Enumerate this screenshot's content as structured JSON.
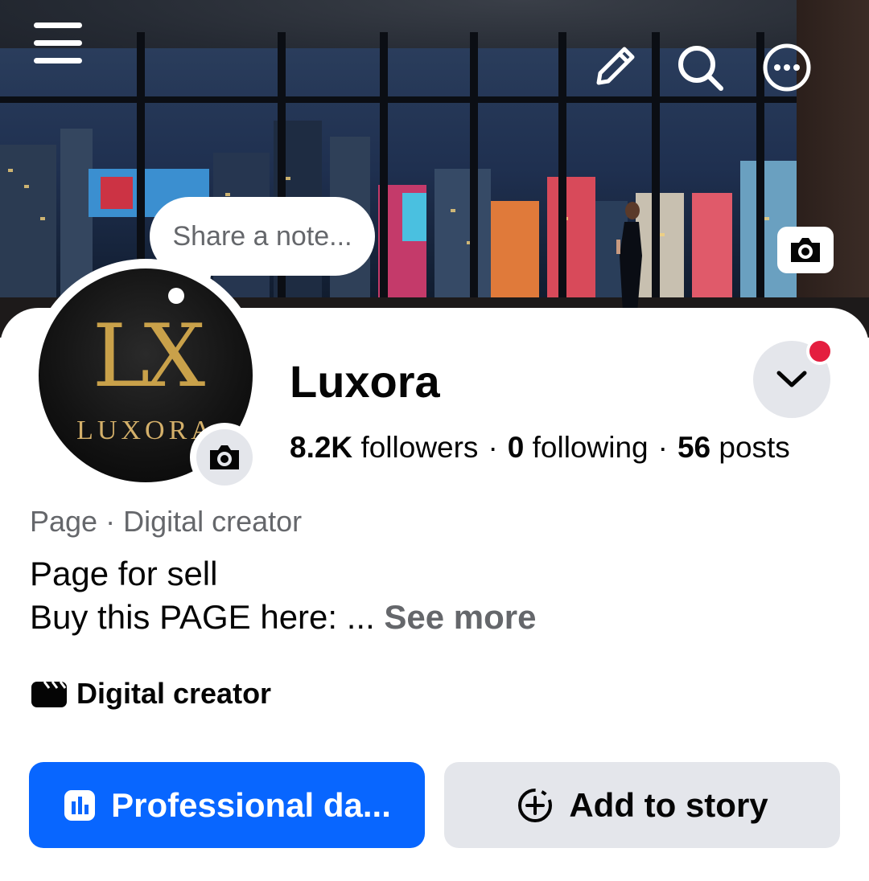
{
  "note": {
    "placeholder": "Share a note..."
  },
  "profile": {
    "name": "Luxora",
    "logo_monogram": "LX",
    "logo_wordmark": "LUXORA",
    "followers_count": "8.2K",
    "followers_label": "followers",
    "following_count": "0",
    "following_label": "following",
    "posts_count": "56",
    "posts_label": "posts",
    "separator": "·",
    "category": "Page · Digital creator",
    "bio_line1": "Page for sell",
    "bio_line2": "Buy this PAGE here: ... ",
    "see_more": "See more",
    "creator_label": "Digital creator"
  },
  "buttons": {
    "professional_dashboard": "Professional da...",
    "add_to_story": "Add to story"
  },
  "icons": [
    "menu-icon",
    "edit-icon",
    "search-icon",
    "more-icon",
    "camera-icon",
    "chevron-down-icon",
    "clapperboard-icon",
    "dashboard-icon",
    "add-story-icon"
  ],
  "colors": {
    "primary": "#0866ff",
    "secondary_bg": "#e4e6eb",
    "notification": "#e41e3f",
    "muted_text": "#65676b",
    "logo_gold": "#c9a14a"
  }
}
